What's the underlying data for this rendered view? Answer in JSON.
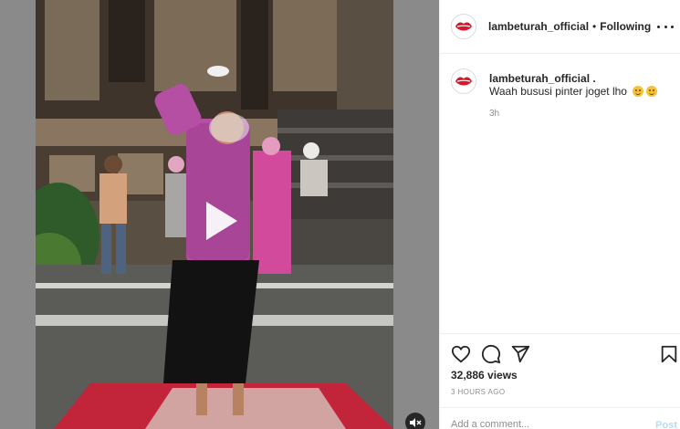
{
  "post": {
    "username": "lambeturah_official",
    "separator": "•",
    "follow_status": "Following",
    "caption_username": "lambeturah_official .",
    "caption_text": "Waah bususi pinter joget lho",
    "caption_emojis": [
      "grinning-face-emoji",
      "grinning-face-emoji"
    ],
    "caption_age": "3h",
    "views": "32,886 views",
    "posted_ago": "3 HOURS AGO"
  },
  "comment": {
    "placeholder": "Add a comment...",
    "post_label": "Post"
  },
  "icons": {
    "like": "heart-icon",
    "comment": "comment-icon",
    "share": "paper-plane-icon",
    "save": "bookmark-icon",
    "more": "more-options-icon",
    "play": "play-icon",
    "mute": "muted-speaker-icon"
  },
  "colors": {
    "brand_red": "#d7182a",
    "text": "#262626",
    "muted": "#8e8e8e",
    "post_disabled": "#b2dffc"
  }
}
